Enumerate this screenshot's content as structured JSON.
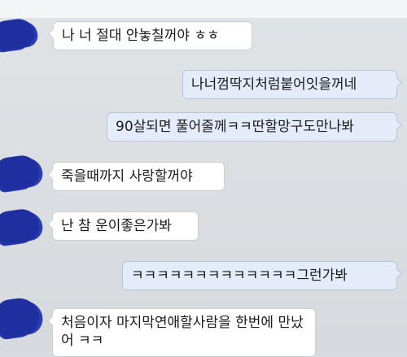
{
  "messages": [
    {
      "text": "나 너 절대 안놓칠꺼야 ㅎㅎ"
    },
    {
      "text": "나너껌딱지처럼붙어잇을꺼네"
    },
    {
      "text": "90살되면 풀어줄께ㅋㅋ딴할망구도만나봐"
    },
    {
      "text": "죽을때까지 사랑할꺼야"
    },
    {
      "text": "난 참 운이좋은가봐"
    },
    {
      "text": "ㅋㅋㅋㅋㅋㅋㅋㅋㅋㅋㅋㅋㅋ그런가봐"
    },
    {
      "text": "처음이자 마지막연애할사람을 한번에 만났어 ㅋㅋ"
    }
  ]
}
